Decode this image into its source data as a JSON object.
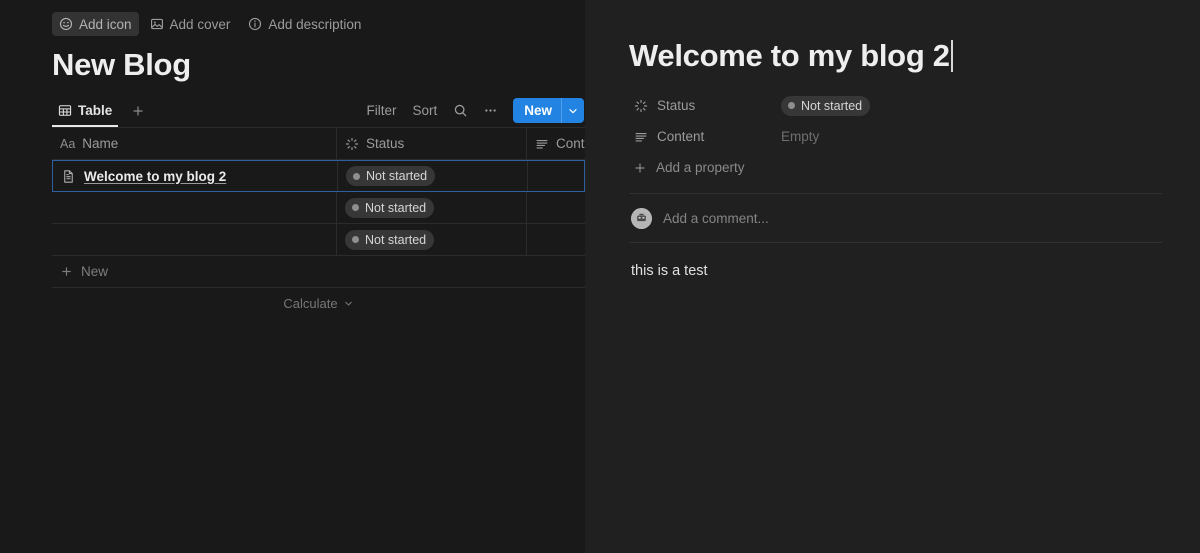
{
  "theme": {
    "left_bg": "#191919",
    "right_bg": "#202020",
    "accent_blue": "#2383e2",
    "selection_border": "#2f5f9e",
    "grid_line": "#2c2c2c",
    "pill_bg": "#373737",
    "text_primary": "#e3e3e3",
    "text_muted": "#9b9b9b"
  },
  "left": {
    "meta_bar": [
      {
        "icon": "smiley-icon",
        "label": "Add icon",
        "hovered": true
      },
      {
        "icon": "image-icon",
        "label": "Add cover",
        "hovered": false
      },
      {
        "icon": "info-icon",
        "label": "Add description",
        "hovered": false
      }
    ],
    "database_title": "New Blog",
    "view_tabs": [
      {
        "icon": "table-icon",
        "label": "Table",
        "active": true
      }
    ],
    "add_view_label": "+",
    "toolbar": {
      "filter_label": "Filter",
      "sort_label": "Sort",
      "search_icon": "search-icon",
      "more_icon": "ellipsis-icon",
      "new_label": "New",
      "new_caret_icon": "chevron-down-icon"
    },
    "table": {
      "columns": [
        {
          "key": "name",
          "label": "Name",
          "icon": "title-aa-icon",
          "type_prefix": "Aa"
        },
        {
          "key": "status",
          "label": "Status",
          "icon": "status-spinner-icon"
        },
        {
          "key": "content",
          "label": "Conte",
          "icon": "text-lines-icon"
        }
      ],
      "rows": [
        {
          "name": "Welcome to my blog 2",
          "icon": "page-doc-icon",
          "status": "Not started",
          "content": "",
          "selected": true
        },
        {
          "name": "",
          "icon": "",
          "status": "Not started",
          "content": "",
          "selected": false
        },
        {
          "name": "",
          "icon": "",
          "status": "Not started",
          "content": "",
          "selected": false
        }
      ],
      "new_row_label": "New",
      "calculate_label": "Calculate"
    }
  },
  "right": {
    "page_title": "Welcome to my blog 2",
    "properties": [
      {
        "icon": "status-spinner-icon",
        "label": "Status",
        "value": "Not started",
        "value_kind": "pill"
      },
      {
        "icon": "text-lines-icon",
        "label": "Content",
        "value": "Empty",
        "value_kind": "empty"
      }
    ],
    "add_property_label": "Add a property",
    "comment": {
      "avatar_icon": "user-avatar",
      "placeholder": "Add a comment..."
    },
    "body_text": "this is a test"
  }
}
